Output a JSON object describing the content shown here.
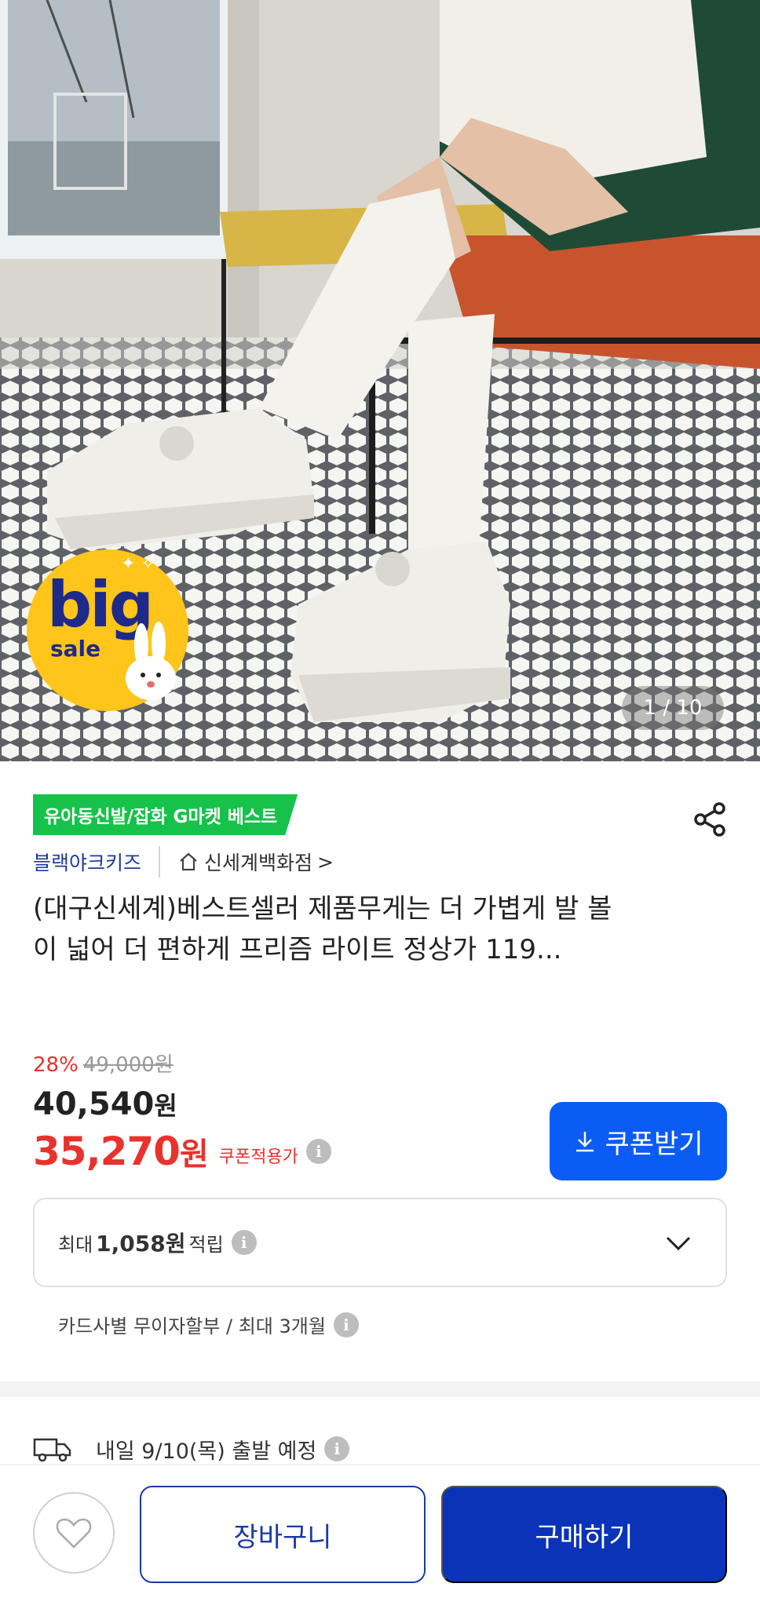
{
  "gallery": {
    "counter": "1 / 10",
    "badge_big": "big",
    "badge_sale": "sale"
  },
  "product": {
    "best_tag": "유아동신발/잡화 G마켓 베스트",
    "brand": "블랙야크키즈",
    "store": "신세계백화점",
    "store_chevron": ">",
    "title": "(대구신세계)베스트셀러 제품무게는 더 가볍게 발 볼이 넓어 더 편하게  프리즘 라이트 정상가 119...",
    "discount": "28%",
    "original_price": "49,000원",
    "price_number": "40,540",
    "price_unit": "원",
    "coupon_price_number": "35,270",
    "coupon_price_unit": "원",
    "coupon_label": "쿠폰적용가",
    "coupon_button": "쿠폰받기"
  },
  "points": {
    "prefix": "최대",
    "amount": "1,058원",
    "suffix": "적립"
  },
  "installment": "카드사별 무이자할부 / 최대 3개월",
  "delivery": "내일 9/10(목) 출발 예정",
  "bottom_bar": {
    "cart": "장바구니",
    "buy": "구매하기"
  },
  "colors": {
    "best_tag": "#17c24a",
    "brand": "#1e3a9e",
    "sale_red": "#e8322d",
    "coupon_button": "#0a5cf5",
    "buy_button": "#0b33b8"
  }
}
